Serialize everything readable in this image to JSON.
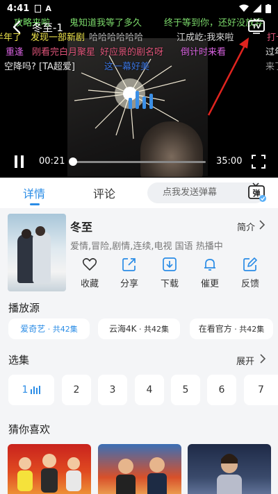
{
  "status": {
    "time": "4:41"
  },
  "video": {
    "title": "冬至-1",
    "current_time": "00:21",
    "duration": "35:00",
    "progress": 0.01,
    "danmu": [
      "攻略来啦",
      "鬼知道我等了多久",
      "终于等到你，还好没放弃",
      "半年了",
      "发现一部新剧",
      "哈哈哈哈哈哈",
      "江成屹:我來啦",
      "重逢",
      "刚看完白月聚星",
      "好应景的剧名呀",
      "倒计时来看",
      "过年",
      "空降吗? [TA超爱]",
      "这一幕好美",
      "打卡",
      "来了"
    ]
  },
  "tabs": {
    "details": "详情",
    "comments": "评论"
  },
  "danmu_input": {
    "placeholder": "点我发送弹幕",
    "btn": "弹"
  },
  "show": {
    "title": "冬至",
    "brief": "简介",
    "tags": "爱情,冒险,剧情,连续,电视 国语 热播中",
    "actions": [
      "收藏",
      "分享",
      "下载",
      "催更",
      "反馈"
    ]
  },
  "sources": {
    "title": "播放源",
    "items": [
      {
        "name": "爱奇艺",
        "count": " · 共42集"
      },
      {
        "name": "云海4K",
        "count": " · 共42集"
      },
      {
        "name": "在看官方",
        "count": " · 共42集"
      }
    ]
  },
  "episodes": {
    "title": "选集",
    "expand": "展开",
    "items": [
      "1",
      "2",
      "3",
      "4",
      "5",
      "6",
      "7"
    ]
  },
  "recommend": {
    "title": "猜你喜欢"
  }
}
